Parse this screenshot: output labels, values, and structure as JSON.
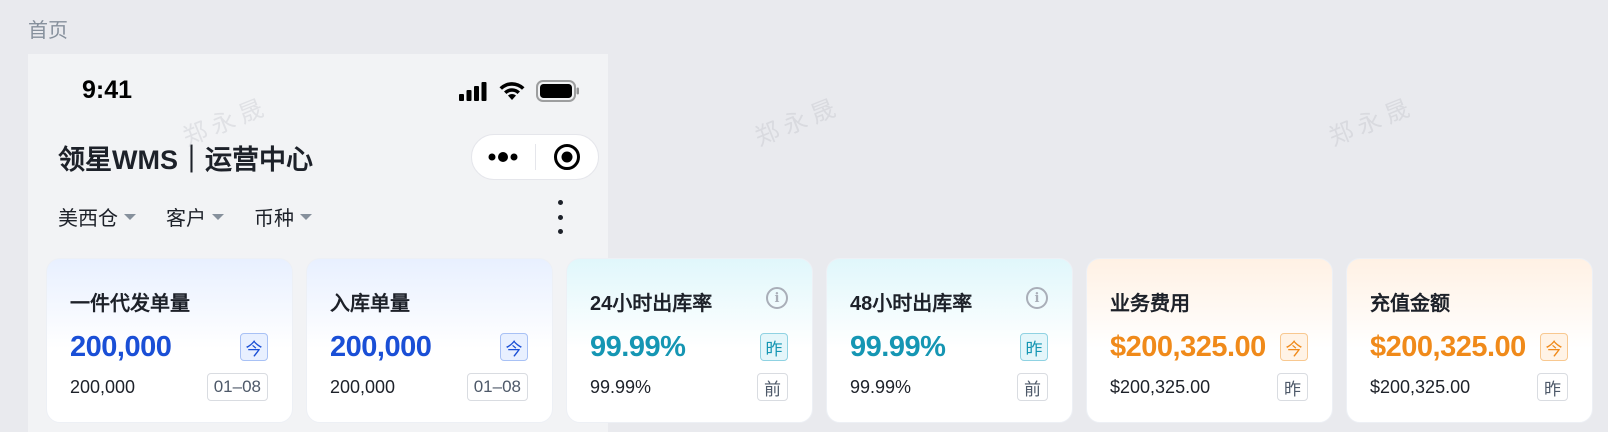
{
  "breadcrumb": "首页",
  "status_bar": {
    "time": "9:41"
  },
  "nav": {
    "title": "领星WMS｜运营中心"
  },
  "filters": [
    {
      "label": "美西仓"
    },
    {
      "label": "客户"
    },
    {
      "label": "币种"
    }
  ],
  "watermark": "郑永晟",
  "cards": [
    {
      "title": "一件代发单量",
      "value": "200,000",
      "tag": "今",
      "sub": "200,000",
      "sub_tag": "01–08",
      "theme": "blue",
      "info": false
    },
    {
      "title": "入库单量",
      "value": "200,000",
      "tag": "今",
      "sub": "200,000",
      "sub_tag": "01–08",
      "theme": "blue",
      "info": false
    },
    {
      "title": "24小时出库率",
      "value": "99.99%",
      "tag": "昨",
      "sub": "99.99%",
      "sub_tag": "前",
      "theme": "cyan",
      "info": true
    },
    {
      "title": "48小时出库率",
      "value": "99.99%",
      "tag": "昨",
      "sub": "99.99%",
      "sub_tag": "前",
      "theme": "cyan",
      "info": true
    },
    {
      "title": "业务费用",
      "value": "$200,325.00",
      "tag": "今",
      "sub": "$200,325.00",
      "sub_tag": "昨",
      "theme": "orange",
      "info": false
    },
    {
      "title": "充值金额",
      "value": "$200,325.00",
      "tag": "今",
      "sub": "$200,325.00",
      "sub_tag": "昨",
      "theme": "orange",
      "info": false
    }
  ],
  "colors": {
    "blue": "#1a4fd6",
    "cyan": "#1596b3",
    "orange": "#f08a1a",
    "background": "#e9eaee"
  }
}
